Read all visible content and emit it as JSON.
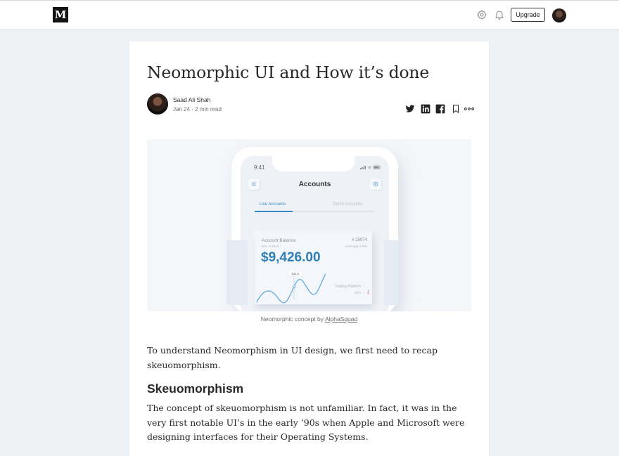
{
  "header": {
    "logo_text": "M",
    "upgrade_label": "Upgrade"
  },
  "article": {
    "title": "Neomorphic UI and How it’s done",
    "author": "Saad Ali Shah",
    "meta": "Jan 24 · 2 min read",
    "figure": {
      "time": "9:41",
      "screen_title": "Accounts",
      "tab_live": "Live Accounts",
      "tab_demo": "Demo Accounts",
      "balance_label": "Account Balance",
      "balance_date": "Dec. 6 2019",
      "account_id": "# 25974",
      "leverage": "Leverage 1:250",
      "balance_amount": "$9,426.00",
      "chart_tag": "$3211",
      "platform": "Trading Platform",
      "platform_name": "MT4"
    },
    "caption_prefix": "Neomorphic concept by ",
    "caption_link": "AlphaSquad",
    "intro": "To understand Neomorphism in UI design, we first need to recap skeuomorphism.",
    "section_heading": "Skeuomorphism",
    "section_text": "The concept of skeuomorphism is not unfamiliar. In fact, it was in the very first notable UI’s in the early ’90s when Apple and Microsoft were designing interfaces for their Operating Systems."
  },
  "icons": [
    "settings-icon",
    "bell-icon",
    "twitter-icon",
    "linkedin-icon",
    "facebook-icon",
    "bookmark-icon",
    "more-icon"
  ],
  "colors": {
    "accent_blue": "#2f7fb5",
    "down_red": "#e06767",
    "text": "#292929"
  }
}
